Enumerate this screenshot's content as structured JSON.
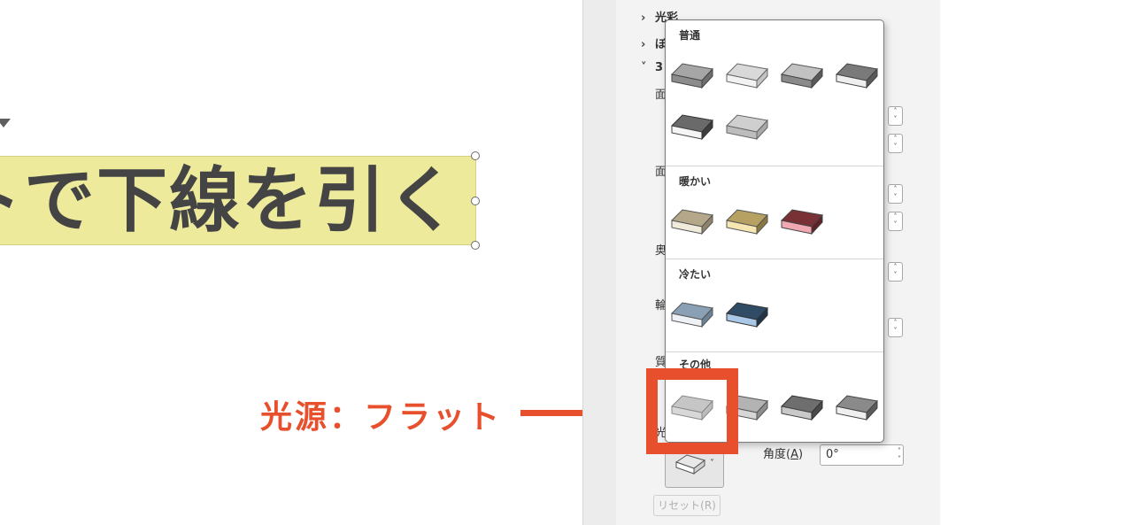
{
  "slide": {
    "textbox_text": "トで下線を引く"
  },
  "annotation": {
    "text": "光源：フラット",
    "color": "#e8502d"
  },
  "pane": {
    "rows": [
      {
        "label": "光彩",
        "expanded": false
      },
      {
        "label": "ぼ",
        "expanded": false
      },
      {
        "label": "3",
        "expanded": true
      }
    ],
    "clipped_labels": [
      "面",
      "面",
      "奥",
      "輪",
      "質",
      "光"
    ],
    "angle": {
      "label_base": "角度(",
      "label_key": "A",
      "label_end": ")",
      "value": "0°"
    },
    "light_button_icon": "lighting-flat-icon",
    "reset_label": "リセット(R)"
  },
  "gallery": {
    "sections": [
      {
        "title": "普通",
        "items": [
          "normal-1",
          "normal-2",
          "normal-3",
          "normal-4",
          "normal-5",
          "normal-6"
        ]
      },
      {
        "title": "暖かい",
        "items": [
          "warm-1",
          "warm-2",
          "warm-3"
        ]
      },
      {
        "title": "冷たい",
        "items": [
          "cool-1",
          "cool-2"
        ]
      },
      {
        "title": "その他",
        "items": [
          "flat",
          "other-2",
          "other-3",
          "other-4"
        ]
      }
    ],
    "selected_item": "flat"
  }
}
